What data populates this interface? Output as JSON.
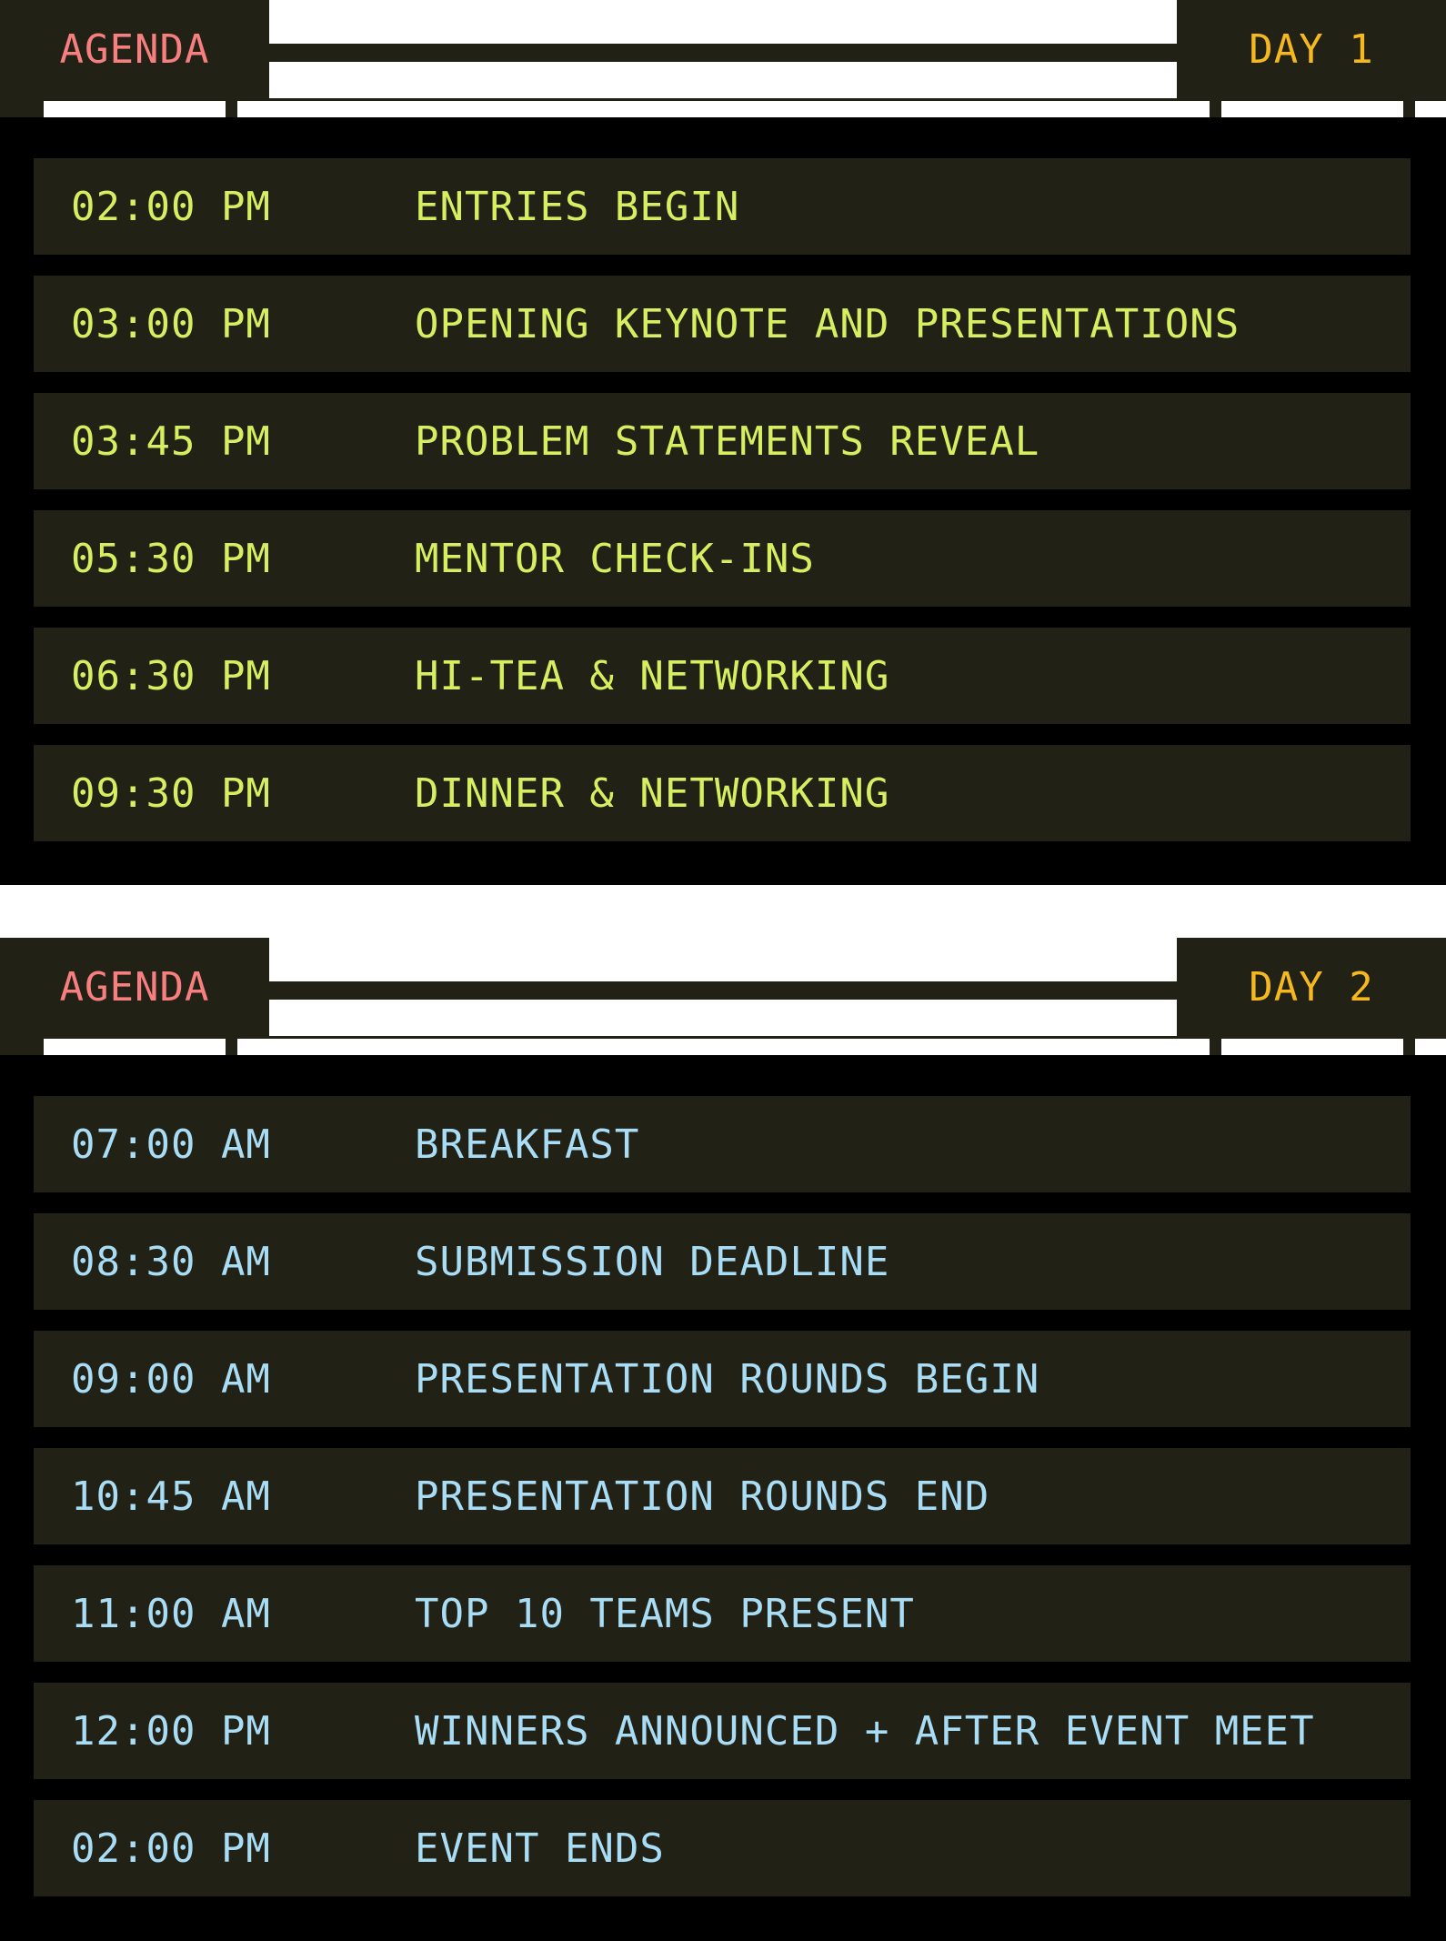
{
  "colors": {
    "agenda_label": "#f77f80",
    "day_label": "#f5b81e",
    "day1_text": "#d6ef60",
    "day2_text": "#a9dcf5",
    "panel_bg": "#000000",
    "row_bg": "#222116"
  },
  "days": [
    {
      "agenda_label": "AGENDA",
      "day_label": "DAY 1",
      "items": [
        {
          "time": "02:00 PM",
          "event": "ENTRIES BEGIN"
        },
        {
          "time": "03:00 PM",
          "event": "OPENING KEYNOTE AND PRESENTATIONS"
        },
        {
          "time": "03:45 PM",
          "event": "PROBLEM STATEMENTS REVEAL"
        },
        {
          "time": "05:30 PM",
          "event": "MENTOR CHECK-INS"
        },
        {
          "time": "06:30 PM",
          "event": "HI-TEA & NETWORKING"
        },
        {
          "time": "09:30 PM",
          "event": "DINNER & NETWORKING"
        }
      ]
    },
    {
      "agenda_label": "AGENDA",
      "day_label": "DAY 2",
      "items": [
        {
          "time": "07:00 AM",
          "event": "BREAKFAST"
        },
        {
          "time": "08:30 AM",
          "event": "SUBMISSION DEADLINE"
        },
        {
          "time": "09:00 AM",
          "event": "PRESENTATION ROUNDS BEGIN"
        },
        {
          "time": "10:45 AM",
          "event": "PRESENTATION ROUNDS END"
        },
        {
          "time": "11:00 AM",
          "event": "TOP 10 TEAMS PRESENT"
        },
        {
          "time": "12:00 PM",
          "event": "WINNERS ANNOUNCED + AFTER EVENT MEET"
        },
        {
          "time": "02:00 PM",
          "event": "EVENT ENDS"
        }
      ]
    }
  ]
}
